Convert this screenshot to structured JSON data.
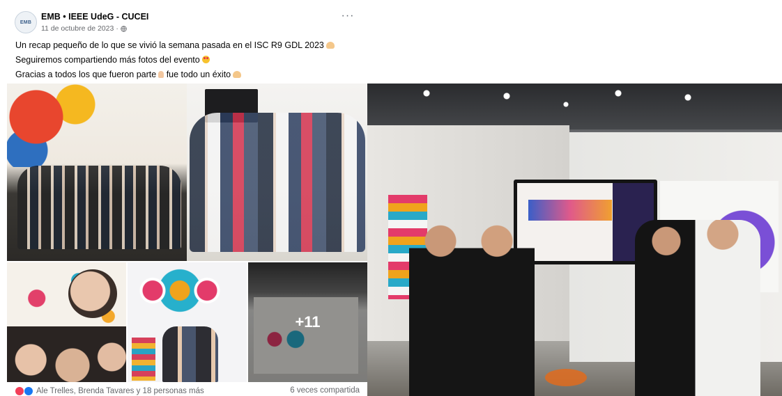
{
  "post": {
    "page_name": "EMB • IEEE UdeG - CUCEI",
    "date": "11 de octubre de 2023",
    "date_separator": "·",
    "avatar_text": "EMB",
    "more_label": "···",
    "lines": [
      "Un recap pequeño de lo que se vivió la semana pasada en el ISC R9 GDL 2023",
      "Seguiremos compartiendo más fotos del evento",
      "Gracias a todos los que fueron parte",
      "fue todo un éxito"
    ],
    "more_photos": "+11",
    "reactions_text": "Ale Trelles, Brenda Tavares y 18 personas más",
    "shares_text": "6 veces compartida"
  },
  "colors": {
    "text_primary": "#050505",
    "text_secondary": "#65676b",
    "like_blue": "#1877f2",
    "love_red": "#f33e58"
  }
}
